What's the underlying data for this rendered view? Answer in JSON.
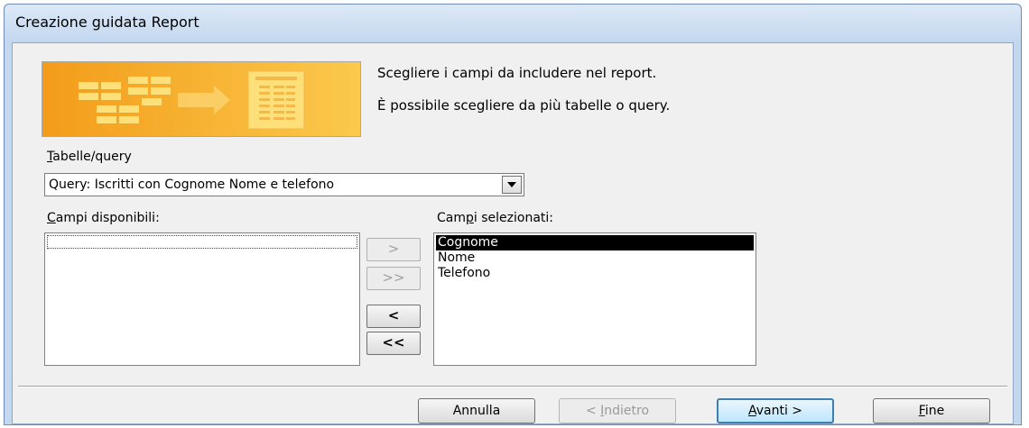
{
  "window": {
    "title": "Creazione guidata Report"
  },
  "intro": {
    "line1": "Scegliere i campi da includere nel report.",
    "line2": "È possibile scegliere da più tabelle o query."
  },
  "tables_query": {
    "label_accel": "T",
    "label_rest": "abelle/query",
    "selected": "Query: Iscritti con Cognome Nome e telefono"
  },
  "available_fields": {
    "label_accel": "C",
    "label_rest": "ampi disponibili:",
    "items": []
  },
  "selected_fields": {
    "label_pre": "Cam",
    "label_accel": "p",
    "label_post": "i selezionati:",
    "items": [
      "Cognome",
      "Nome",
      "Telefono"
    ],
    "highlighted": "Cognome"
  },
  "move_buttons": {
    "add_one": ">",
    "add_all": ">>",
    "remove_one": "<",
    "remove_all": "<<"
  },
  "footer": {
    "cancel": "Annulla",
    "back_pre": "< ",
    "back_accel": "I",
    "back_post": "ndietro",
    "next_accel": "A",
    "next_post": "vanti >",
    "finish_accel": "F",
    "finish_post": "ine"
  },
  "colors": {
    "banner_orange": "#f5a623",
    "banner_yellow": "#fde07a",
    "selection": "#000000",
    "default_button_border": "#3c7fb1"
  },
  "icons": {
    "banner": "report-wizard-banner",
    "dropdown": "chevron-down-icon"
  }
}
